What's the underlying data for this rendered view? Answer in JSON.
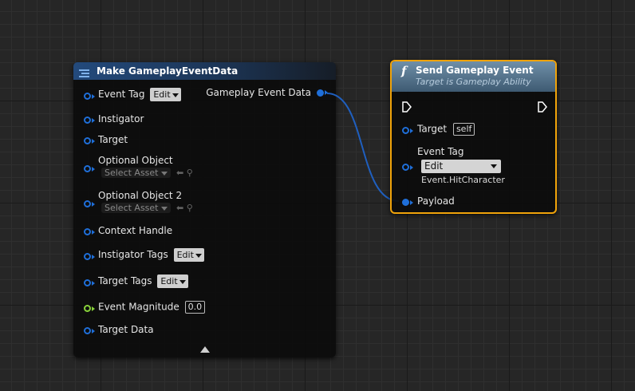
{
  "make_node": {
    "title": "Make GameplayEventData",
    "output_label": "Gameplay Event Data",
    "event_tag_label": "Event Tag",
    "event_tag_edit": "Edit",
    "instigator_label": "Instigator",
    "target_label": "Target",
    "optional_object_label": "Optional Object",
    "optional_object_placeholder": "Select Asset",
    "optional_object2_label": "Optional Object 2",
    "optional_object2_placeholder": "Select Asset",
    "context_handle_label": "Context Handle",
    "instigator_tags_label": "Instigator Tags",
    "instigator_tags_edit": "Edit",
    "target_tags_label": "Target Tags",
    "target_tags_edit": "Edit",
    "event_magnitude_label": "Event Magnitude",
    "event_magnitude_value": "0.0",
    "target_data_label": "Target Data",
    "header_color": "#1c3a63",
    "pin_color": "#1f6fd9",
    "float_pin_color": "#88d23a"
  },
  "send_node": {
    "icon": "f",
    "title": "Send Gameplay Event",
    "subtitle": "Target is Gameplay Ability",
    "target_label": "Target",
    "target_value": "self",
    "event_tag_label": "Event Tag",
    "event_tag_edit": "Edit",
    "event_tag_value": "Event.HitCharacter",
    "payload_label": "Payload",
    "border_color": "#f0a30a"
  }
}
